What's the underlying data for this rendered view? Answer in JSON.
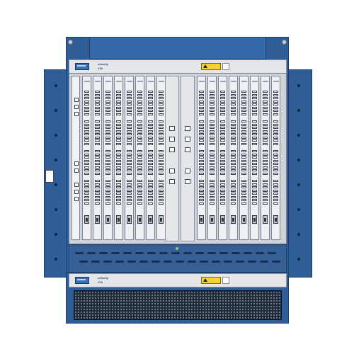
{
  "upper_chassis": {
    "brand": "velocity",
    "model": "V16"
  },
  "lower_chassis": {
    "brand": "velocity",
    "model": "V16"
  },
  "colors": {
    "chassis_blue": "#2f5e97",
    "panel_steel": "#e4e6ea",
    "warning_yellow": "#f4d23a",
    "vent_mesh": "#1e2a38"
  },
  "icons": {
    "warning": "warning-triangle-icon",
    "logo": "brand-logo-icon",
    "ground": "ground-symbol-icon"
  }
}
